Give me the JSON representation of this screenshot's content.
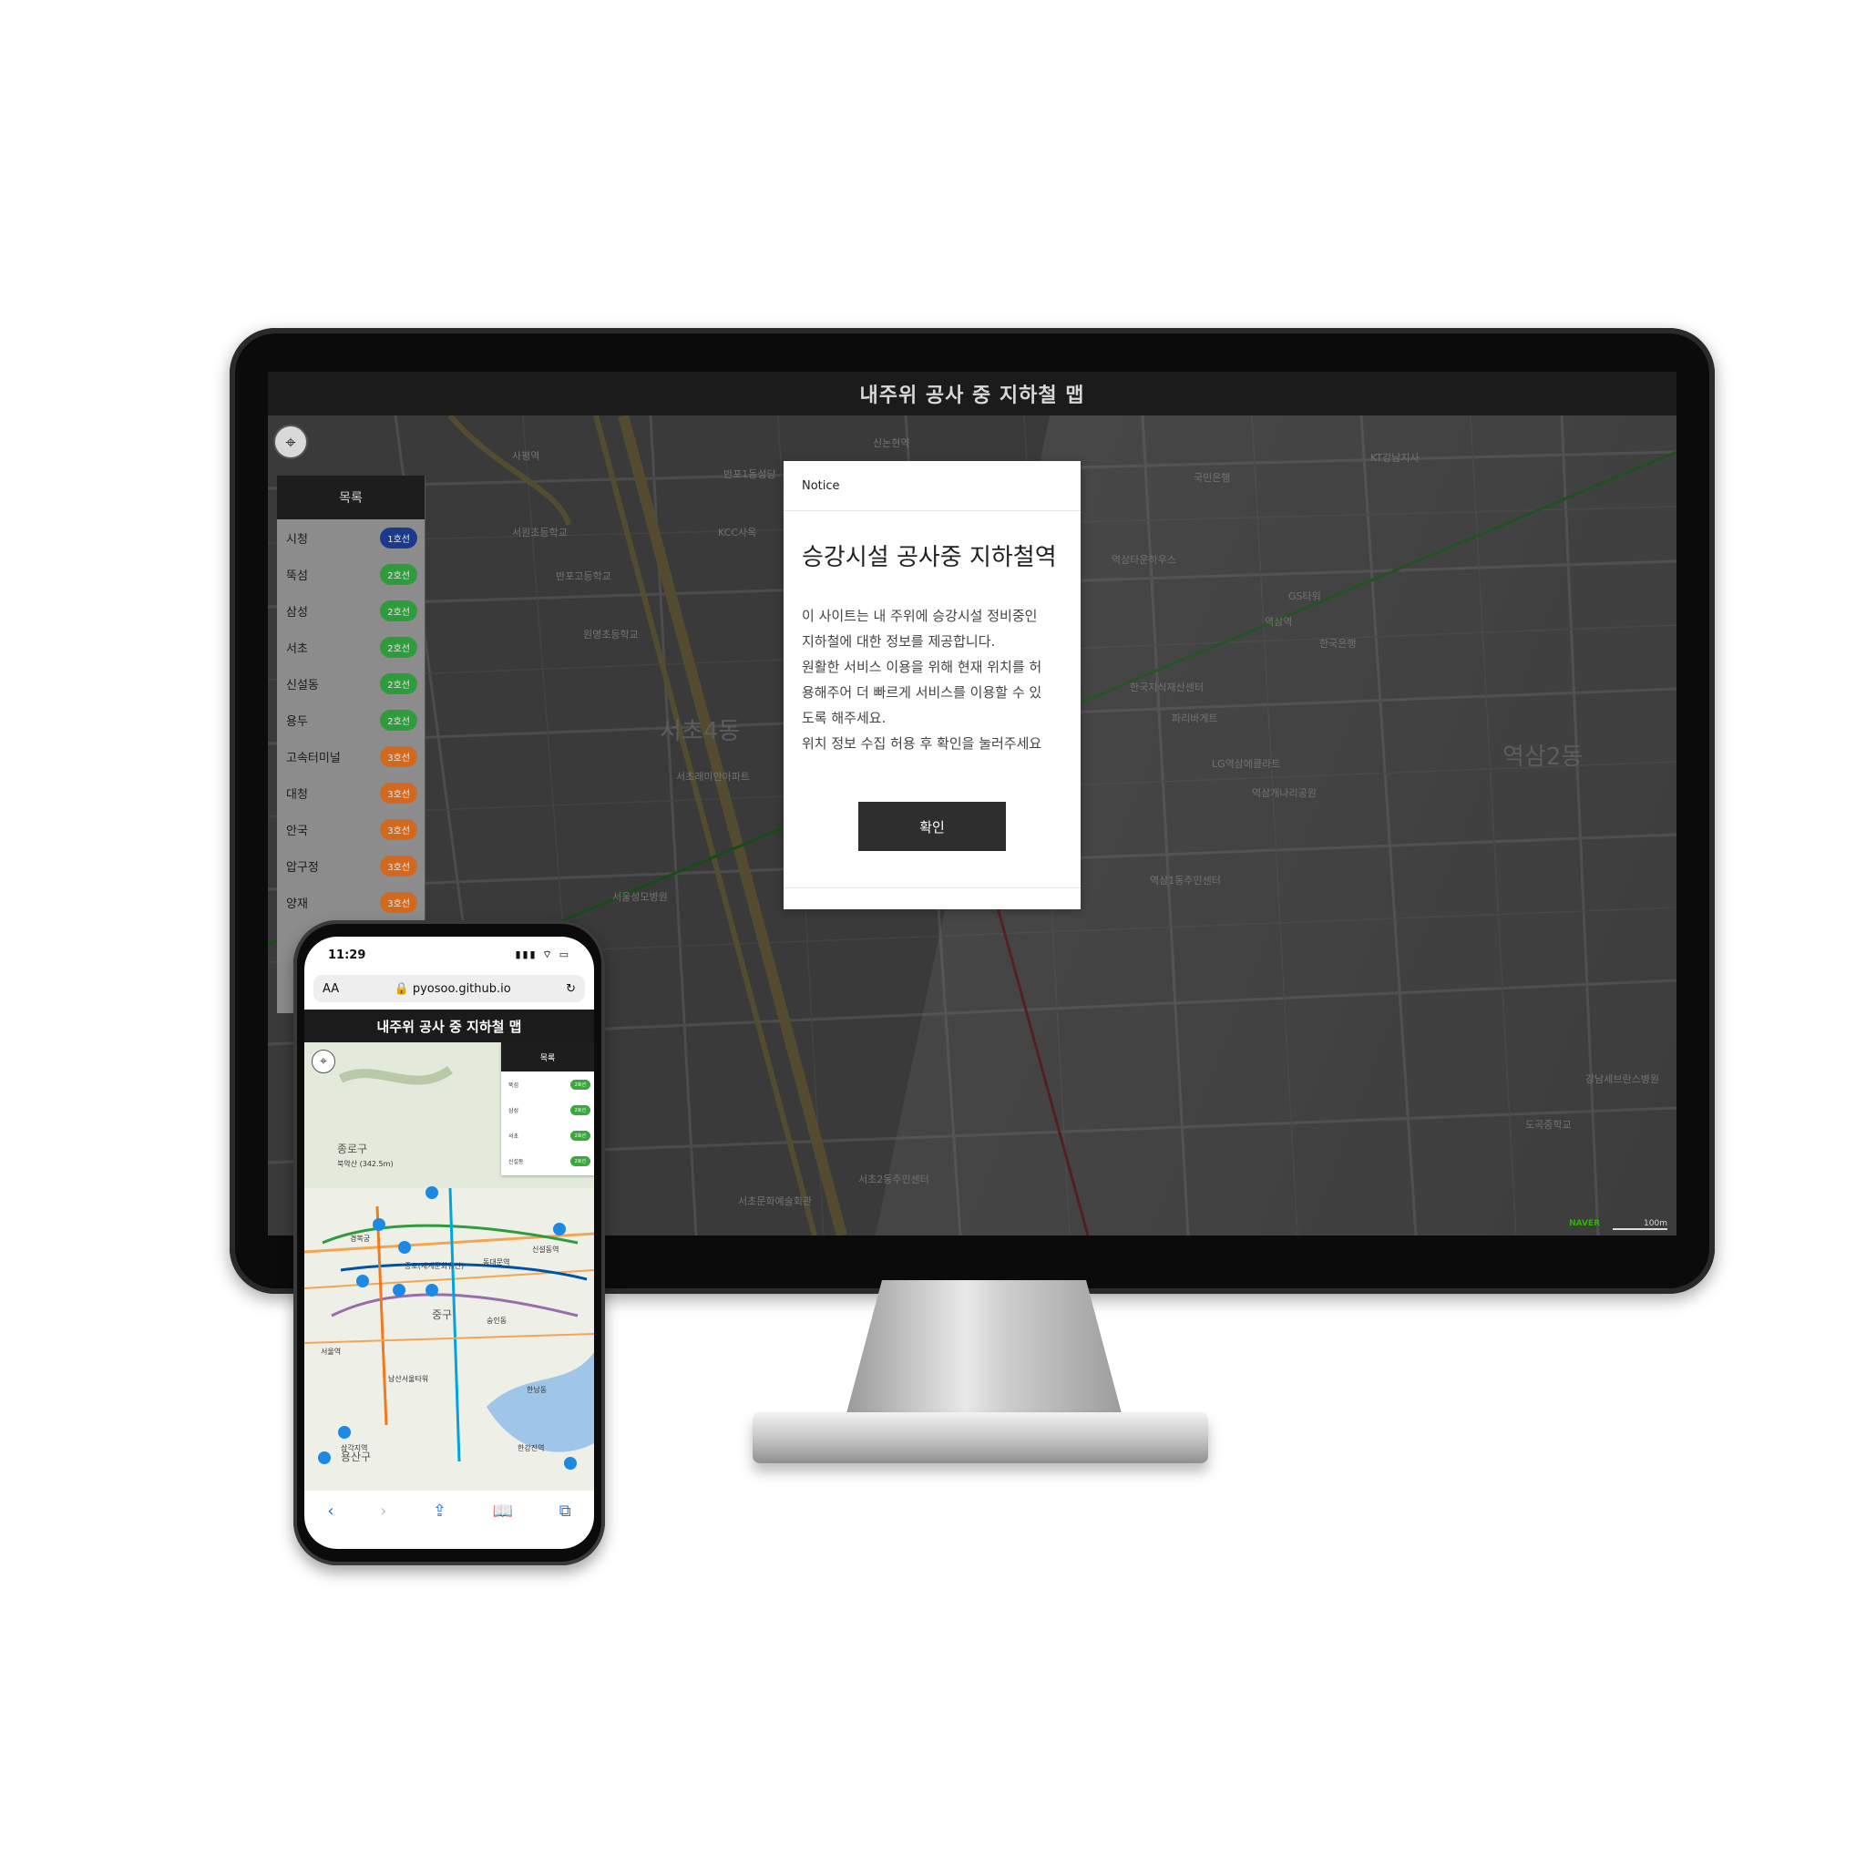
{
  "app": {
    "title": "내주위 공사 중 지하철 맵"
  },
  "sidebar": {
    "heading": "목록",
    "stations": [
      {
        "name": "시청",
        "line": "1호선",
        "color": "#1b3a8c"
      },
      {
        "name": "뚝섬",
        "line": "2호선",
        "color": "#2e9b3c"
      },
      {
        "name": "삼성",
        "line": "2호선",
        "color": "#2e9b3c"
      },
      {
        "name": "서초",
        "line": "2호선",
        "color": "#2e9b3c"
      },
      {
        "name": "신설동",
        "line": "2호선",
        "color": "#2e9b3c"
      },
      {
        "name": "용두",
        "line": "2호선",
        "color": "#2e9b3c"
      },
      {
        "name": "고속터미널",
        "line": "3호선",
        "color": "#d2691e"
      },
      {
        "name": "대청",
        "line": "3호선",
        "color": "#d2691e"
      },
      {
        "name": "안국",
        "line": "3호선",
        "color": "#d2691e"
      },
      {
        "name": "압구정",
        "line": "3호선",
        "color": "#d2691e"
      },
      {
        "name": "양재",
        "line": "3호선",
        "color": "#d2691e"
      }
    ]
  },
  "map": {
    "labels": [
      "사평역",
      "신논현역",
      "역삼역",
      "서초4동",
      "역삼2동",
      "반포1동성당",
      "KCC사옥",
      "서원초등학교",
      "반포고등학교",
      "원명초등학교",
      "서초래미안아파트",
      "국민은행",
      "KT강남지사",
      "역삼타운하우스",
      "GS타워",
      "한국은행",
      "한국지식재산센터",
      "파리바게트",
      "LG역삼에클라트",
      "역삼개나리공원",
      "서초2동주민센터",
      "강남세브란스병원",
      "도곡중학교",
      "역삼1동주민센터",
      "서울성모병원",
      "서초문화예술회관"
    ],
    "districts": [
      "서초4동",
      "역삼2동"
    ],
    "attribution": "NAVER",
    "scale": "100m"
  },
  "notice": {
    "header": "Notice",
    "title": "승강시설 공사중 지하철역",
    "body": "이 사이트는 내 주위에 승강시설 정비중인\n지하철에 대한 정보를 제공합니다.\n원활한 서비스 이용을 위해 현재 위치를 허\n용해주어 더 빠르게 서비스를 이용할 수 있\n도록 해주세요.\n위치 정보 수집 허용 후 확인을 눌러주세요",
    "confirm": "확인"
  },
  "phone": {
    "time": "11:29",
    "status_icons": "▮▮▮ ⌔ ▭",
    "text_size": "AA",
    "url": "🔒 pyosoo.github.io",
    "reload": "↻",
    "header": "내주위 공사 중 지하철 맵",
    "list_heading": "목록",
    "list_rows": [
      {
        "name": "뚝섬",
        "line": "2호선"
      },
      {
        "name": "삼성",
        "line": "2호선"
      },
      {
        "name": "서초",
        "line": "2호선"
      },
      {
        "name": "신설동",
        "line": "2호선"
      }
    ],
    "map_labels": [
      "종로구",
      "북악산 (342.5m)",
      "경복궁",
      "종로(세계문화유산)",
      "동대문역",
      "신설동역",
      "중구",
      "남산서울타워",
      "용산구",
      "삼각지역",
      "한강진역",
      "서울역",
      "숭인동",
      "한남동"
    ],
    "districts": [
      "종로구",
      "중구",
      "용산구"
    ],
    "toolbar": [
      "‹",
      "›",
      "⇪",
      "📖",
      "⧉"
    ]
  }
}
